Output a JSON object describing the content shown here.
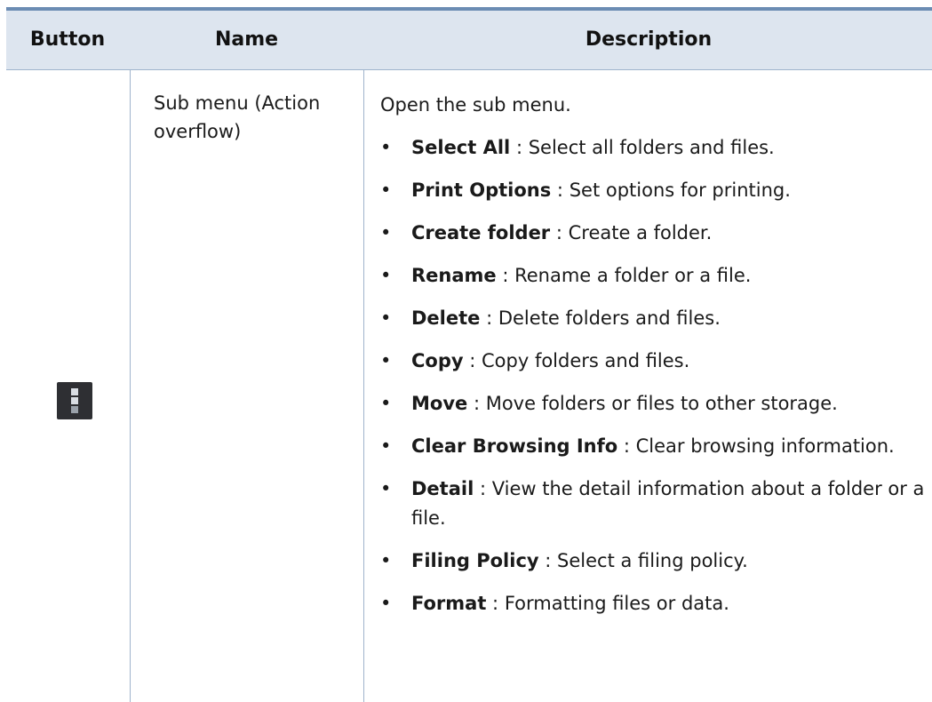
{
  "table": {
    "headers": {
      "button": "Button",
      "name": "Name",
      "description": "Description"
    },
    "row": {
      "icon": "overflow-menu-icon",
      "name": "Sub menu (Action overflow)",
      "intro": "Open the sub menu.",
      "items": [
        {
          "term": "Select All",
          "sep": " : ",
          "text": "Select all folders and files."
        },
        {
          "term": "Print Options",
          "sep": " : ",
          "text": "Set options for printing."
        },
        {
          "term": "Create folder",
          "sep": " : ",
          "text": "Create a folder."
        },
        {
          "term": "Rename",
          "sep": " : ",
          "text": "Rename a folder or a file."
        },
        {
          "term": "Delete",
          "sep": " : ",
          "text": "Delete folders and files."
        },
        {
          "term": "Copy",
          "sep": " : ",
          "text": "Copy folders and files."
        },
        {
          "term": "Move",
          "sep": " : ",
          "text": "Move folders or files to other storage."
        },
        {
          "term": "Clear Browsing Info",
          "sep": " : ",
          "text": "Clear browsing information."
        },
        {
          "term": "Detail",
          "sep": " : ",
          "text": "View the detail information about a folder or a file."
        },
        {
          "term": "Filing Policy",
          "sep": " : ",
          "text": "Select a filing policy."
        },
        {
          "term": "Format",
          "sep": " : ",
          "text": "Formatting files or data."
        }
      ],
      "bullet": "•"
    }
  },
  "colors": {
    "header_bg": "#dde5ef",
    "rule": "#6b8cb3",
    "grid_line": "#9fb3cc",
    "icon_bg": "#2e2f33"
  }
}
